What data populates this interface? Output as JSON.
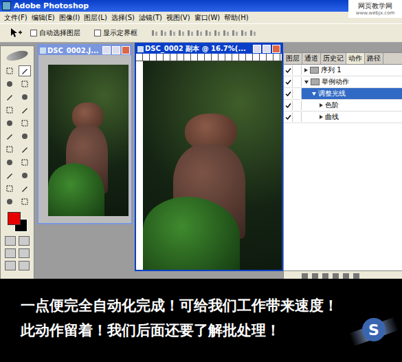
{
  "window": {
    "title": "Adobe Photoshop"
  },
  "watermark": {
    "site": "网页教学网",
    "url": "www.webjx.com"
  },
  "menu": [
    "文件(F)",
    "编辑(E)",
    "图像(I)",
    "图层(L)",
    "选择(S)",
    "滤镜(T)",
    "视图(V)",
    "窗口(W)",
    "帮助(H)"
  ],
  "options_bar": {
    "checkboxes": [
      {
        "label": "自动选择图层",
        "checked": false
      },
      {
        "label": "显示定界框",
        "checked": false
      }
    ]
  },
  "documents": [
    {
      "title": "DSC_0002.J...",
      "selected": false
    },
    {
      "title": "DSC_0002 副本 @ 16.7%(...",
      "selected": true
    }
  ],
  "colors": {
    "foreground": "#e80000",
    "background": "#000000"
  },
  "panel": {
    "tabs": [
      {
        "label": "图层",
        "selected": false
      },
      {
        "label": "通道",
        "selected": false
      },
      {
        "label": "历史记",
        "selected": false
      },
      {
        "label": "动作",
        "selected": true
      },
      {
        "label": "路径",
        "selected": false
      }
    ],
    "actions": [
      {
        "label": "序列 1",
        "kind": "set",
        "depth": 0,
        "expanded": false,
        "selected": false,
        "checked": true
      },
      {
        "label": "举例动作",
        "kind": "set",
        "depth": 0,
        "expanded": true,
        "selected": false,
        "checked": true
      },
      {
        "label": "调整光线",
        "kind": "action",
        "depth": 1,
        "expanded": true,
        "selected": true,
        "checked": true
      },
      {
        "label": "色阶",
        "kind": "step",
        "depth": 2,
        "expanded": false,
        "selected": false,
        "checked": true
      },
      {
        "label": "曲线",
        "kind": "step",
        "depth": 2,
        "expanded": false,
        "selected": false,
        "checked": true
      }
    ]
  },
  "caption": [
    "一点便完全自动化完成！可给我们工作带来速度！",
    "此动作留着！我们后面还要了解批处理！"
  ],
  "logo": {
    "text": "S"
  }
}
